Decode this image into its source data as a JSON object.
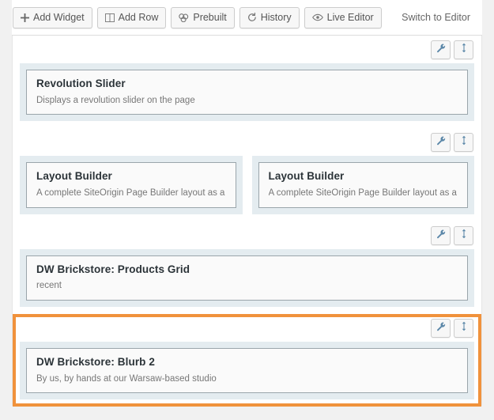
{
  "toolbar": {
    "buttons": [
      {
        "label": "Add Widget",
        "icon": "plus-icon"
      },
      {
        "label": "Add Row",
        "icon": "columns-icon"
      },
      {
        "label": "Prebuilt",
        "icon": "clone-icon"
      },
      {
        "label": "History",
        "icon": "history-icon"
      },
      {
        "label": "Live Editor",
        "icon": "eye-icon"
      }
    ],
    "switch_link": "Switch to Editor"
  },
  "row_actions": {
    "edit_label": "wrench-icon",
    "move_label": "move-vertical-icon"
  },
  "colors": {
    "selected_border": "#f0923c",
    "cell_background": "#e4ecf0",
    "widget_background": "#fafafa",
    "widget_border": "#9aa5ab"
  },
  "rows": [
    {
      "selected": false,
      "cells": [
        {
          "widget": {
            "title": "Revolution Slider",
            "description": "Displays a revolution slider on the page"
          }
        }
      ]
    },
    {
      "selected": false,
      "cells": [
        {
          "widget": {
            "title": "Layout Builder",
            "description": "A complete SiteOrigin Page Builder layout as a"
          }
        },
        {
          "widget": {
            "title": "Layout Builder",
            "description": "A complete SiteOrigin Page Builder layout as a"
          }
        }
      ]
    },
    {
      "selected": false,
      "cells": [
        {
          "widget": {
            "title": "DW Brickstore: Products Grid",
            "description": "recent"
          }
        }
      ]
    },
    {
      "selected": true,
      "cells": [
        {
          "widget": {
            "title": "DW Brickstore: Blurb 2",
            "description": "By us, by hands at our Warsaw-based studio"
          }
        }
      ]
    }
  ]
}
